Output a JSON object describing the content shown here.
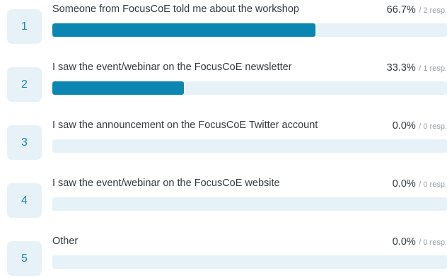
{
  "chart_data": {
    "type": "bar",
    "orientation": "horizontal",
    "unit": "%",
    "categories": [
      "Someone from FocusCoE told me about the workshop",
      "I saw the event/webinar on the FocusCoE newsletter",
      "I saw the announcement on the FocusCoE Twitter account",
      "I saw the event/webinar on the FocusCoE website",
      "Other"
    ],
    "values": [
      66.7,
      33.3,
      0.0,
      0.0,
      0.0
    ],
    "responses": [
      2,
      1,
      0,
      0,
      0
    ],
    "xlim": [
      0,
      100
    ],
    "grid": false,
    "colors": {
      "fill": "#0a86b0",
      "track": "#e6f2f7",
      "number_badge": "#e6f2f7",
      "number_text": "#1f86b2"
    }
  },
  "rows": [
    {
      "number": "1",
      "label": "Someone from FocusCoE told me about the workshop",
      "percent_text": "66.7%",
      "responses_text": "/ 2 resp."
    },
    {
      "number": "2",
      "label": "I saw the event/webinar on the FocusCoE newsletter",
      "percent_text": "33.3%",
      "responses_text": "/ 1 resp."
    },
    {
      "number": "3",
      "label": "I saw the announcement on the FocusCoE Twitter account",
      "percent_text": "0.0%",
      "responses_text": "/ 0 resp."
    },
    {
      "number": "4",
      "label": "I saw the event/webinar on the FocusCoE website",
      "percent_text": "0.0%",
      "responses_text": "/ 0 resp."
    },
    {
      "number": "5",
      "label": "Other",
      "percent_text": "0.0%",
      "responses_text": "/ 0 resp."
    }
  ]
}
